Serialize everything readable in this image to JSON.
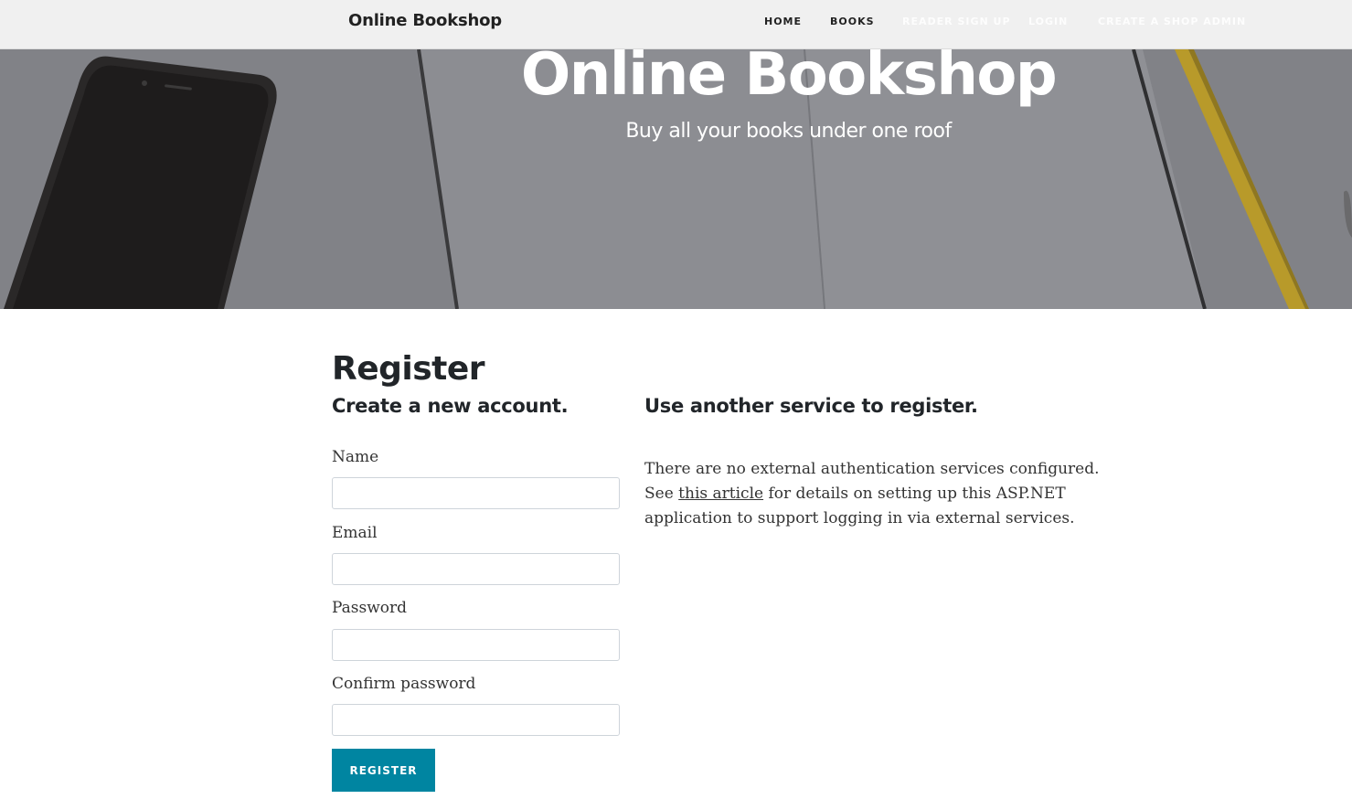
{
  "navbar": {
    "brand": "Online Bookshop",
    "links": [
      {
        "label": "Home"
      },
      {
        "label": "Books"
      },
      {
        "label": "Reader Sign up"
      },
      {
        "label": "Login"
      },
      {
        "label": "Create a shop admin"
      }
    ]
  },
  "hero": {
    "title": "Online Bookshop",
    "subtitle": "Buy all your books under one roof"
  },
  "register": {
    "title": "Register",
    "form_heading": "Create a new account.",
    "fields": [
      {
        "label": "Name",
        "value": ""
      },
      {
        "label": "Email",
        "value": ""
      },
      {
        "label": "Password",
        "value": ""
      },
      {
        "label": "Confirm password",
        "value": ""
      }
    ],
    "submit_label": "Register"
  },
  "external": {
    "heading": "Use another service to register.",
    "text_before": "There are no external authentication services configured. See ",
    "link_text": "this article",
    "text_after": " for details on setting up this ASP.NET application to support logging in via external services."
  },
  "colors": {
    "accent": "#0085a1",
    "hero_overlay": "#808186",
    "navbar_bg": "#f4f4f4"
  }
}
